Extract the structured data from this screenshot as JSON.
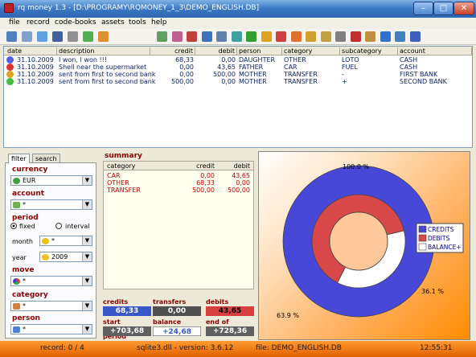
{
  "window": {
    "title": "rq money 1.3  - [D:\\PROGRAMY\\RQMONEY_1_3\\DEMO_ENGLISH.DB]"
  },
  "menu": [
    "file",
    "record",
    "code-books",
    "assets",
    "tools",
    "help"
  ],
  "toolbar_icons": [
    "new-icon",
    "open-icon",
    "copy-icon",
    "save-icon",
    "export-icon",
    "print-icon",
    "add-icon",
    "edit-icon",
    "tag-icon",
    "filter-icon",
    "person-icon",
    "book-icon",
    "report-icon",
    "globe-icon",
    "chart-bar-icon",
    "chart-pie-icon",
    "transfer-icon",
    "folder-icon",
    "key-icon",
    "settings-icon",
    "calendar-icon",
    "table-icon",
    "info-icon",
    "home-icon",
    "help-icon"
  ],
  "grid": {
    "columns": [
      "date",
      "description",
      "credit",
      "debit",
      "person",
      "category",
      "subcategory",
      "account"
    ],
    "rows": [
      {
        "color": "#5060e0",
        "date": "31.10.2009",
        "description": "I won, I won !!!",
        "credit": "68,33",
        "debit": "0,00",
        "person": "DAUGHTER",
        "category": "OTHER",
        "subcategory": "LOTO",
        "account": "CASH"
      },
      {
        "color": "#e03030",
        "date": "31.10.2009",
        "description": "Shell near the supermarket",
        "credit": "0,00",
        "debit": "43,65",
        "person": "FATHER",
        "category": "CAR",
        "subcategory": "FUEL",
        "account": "CASH"
      },
      {
        "color": "#e0a020",
        "date": "31.10.2009",
        "description": "sent from first to second bank",
        "credit": "0,00",
        "debit": "500,00",
        "person": "MOTHER",
        "category": "TRANSFER",
        "subcategory": "-",
        "account": "FIRST BANK"
      },
      {
        "color": "#40c040",
        "date": "31.10.2009",
        "description": "sent from first to second bank",
        "credit": "500,00",
        "debit": "0,00",
        "person": "MOTHER",
        "category": "TRANSFER",
        "subcategory": "+",
        "account": "SECOND BANK"
      }
    ]
  },
  "filter": {
    "tabs": [
      "filter",
      "search"
    ],
    "currency_label": "currency",
    "currency": "EUR",
    "account_label": "account",
    "account": "*",
    "period_label": "period",
    "fixed": "fixed",
    "interval": "interval",
    "month_label": "month",
    "month": "*",
    "year_label": "year",
    "year": "2009",
    "move_label": "move",
    "move": "*",
    "category_label": "category",
    "category": "*",
    "person_label": "person",
    "person": "*"
  },
  "summary": {
    "title": "summary",
    "columns": [
      "category",
      "credit",
      "debit"
    ],
    "rows": [
      {
        "category": "CAR",
        "credit": "0,00",
        "debit": "43,65"
      },
      {
        "category": "OTHER",
        "credit": "68,33",
        "debit": "0,00"
      },
      {
        "category": "TRANSFER",
        "credit": "500,00",
        "debit": "500,00"
      }
    ],
    "credits_label": "credits",
    "credits": "68,33",
    "transfers_label": "transfers",
    "transfers": "0,00",
    "debits_label": "debits",
    "debits": "43,65",
    "start_label": "start of period",
    "start": "+703,68",
    "balance_label": "balance",
    "balance": "+24,68",
    "end_label": "end of period",
    "end": "+728,36"
  },
  "chart_data": {
    "type": "pie",
    "style": "donut",
    "slice_labels": [
      "100.0 %",
      "63.9 %",
      "36.1 %"
    ],
    "outer_ring": [
      {
        "name": "CREDITS",
        "value": 100.0,
        "color": "#4848d8"
      }
    ],
    "inner_ring": [
      {
        "name": "DEBITS",
        "value": 63.9,
        "color": "#d84848"
      },
      {
        "name": "BALANCE+",
        "value": 36.1,
        "color": "#ffffff"
      }
    ],
    "legend": [
      "CREDITS",
      "DEBITS",
      "BALANCE+"
    ],
    "legend_placement": "right",
    "center_color": "#ffc89a"
  },
  "status": {
    "record": "record: 0 / 4",
    "dll": "sqlite3.dll - version: 3.6.12",
    "file": "file: DEMO_ENGLISH.DB",
    "time": "12:55:31"
  }
}
